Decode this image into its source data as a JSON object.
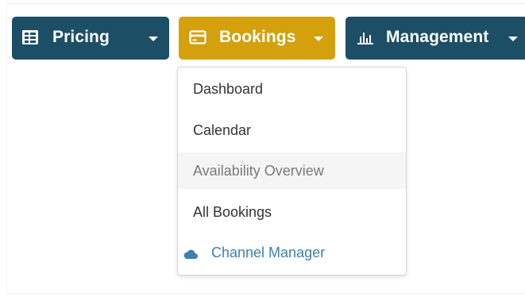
{
  "nav": {
    "pricing": {
      "label": "Pricing",
      "icon": "pricing-table-icon",
      "color": "#1c4f66"
    },
    "bookings": {
      "label": "Bookings",
      "icon": "credit-card-icon",
      "color": "#d4a00b"
    },
    "management": {
      "label": "Management",
      "icon": "bar-chart-icon",
      "color": "#1c4f66"
    }
  },
  "bookings_menu": {
    "items": [
      {
        "label": "Dashboard"
      },
      {
        "label": "Calendar"
      },
      {
        "label": "Availability Overview",
        "state": "hover"
      },
      {
        "label": "All Bookings"
      },
      {
        "label": "Channel Manager",
        "icon": "cloud-icon",
        "color": "#3d7fb5"
      }
    ]
  }
}
